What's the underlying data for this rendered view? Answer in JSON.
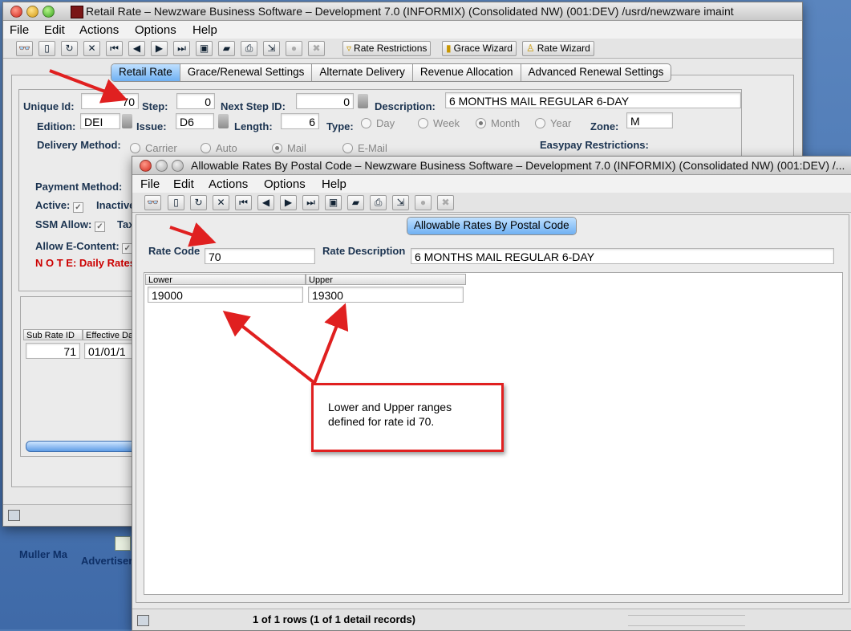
{
  "desktop": {
    "labels": [
      "Muller Ma",
      "Advertiser"
    ]
  },
  "back_window": {
    "title": "Retail Rate – Newzware Business Software – Development 7.0 (INFORMIX) (Consolidated NW)  (001:DEV)  /usrd/newzware  imaint",
    "menu": [
      "File",
      "Edit",
      "Actions",
      "Options",
      "Help"
    ],
    "toolbar_buttons": [
      "Rate Restrictions",
      "Grace Wizard",
      "Rate Wizard"
    ],
    "tabs": [
      "Retail Rate",
      "Grace/Renewal Settings",
      "Alternate Delivery",
      "Revenue Allocation",
      "Advanced Renewal Settings"
    ],
    "form": {
      "unique_id_label": "Unique Id:",
      "unique_id": "70",
      "step_label": "Step:",
      "step": "0",
      "next_step_label": "Next Step ID:",
      "next_step": "0",
      "description_label": "Description:",
      "description": "6 MONTHS MAIL REGULAR 6-DAY",
      "edition_label": "Edition:",
      "edition": "DEI",
      "issue_label": "Issue:",
      "issue": "D6",
      "length_label": "Length:",
      "length": "6",
      "type_label": "Type:",
      "type_options": [
        "Day",
        "Week",
        "Month",
        "Year"
      ],
      "zone_label": "Zone:",
      "zone": "M",
      "delivery_method_label": "Delivery Method:",
      "delivery_options": [
        "Carrier",
        "Auto",
        "Mail",
        "E-Mail"
      ],
      "easypay_label": "Easypay Restrictions:",
      "payment_method_label": "Payment Method:",
      "active_label": "Active:",
      "inactive_label": "Inactive",
      "ssm_allow_label": "SSM Allow:",
      "tax_label": "Tax",
      "allow_econtent_label": "Allow E-Content:",
      "note": "N O T E: Daily Rates"
    },
    "sub_table": {
      "headers": [
        "Sub Rate ID",
        "Effective Da"
      ],
      "row": [
        "71",
        "01/01/1"
      ]
    }
  },
  "front_window": {
    "title": "Allowable Rates By Postal Code – Newzware Business Software – Development 7.0 (INFORMIX) (Consolidated NW)  (001:DEV)  /...",
    "menu": [
      "File",
      "Edit",
      "Actions",
      "Options",
      "Help"
    ],
    "tab": "Allowable Rates By Postal Code",
    "rate_code_label": "Rate Code",
    "rate_code": "70",
    "rate_desc_label": "Rate Description",
    "rate_desc": "6 MONTHS MAIL REGULAR 6-DAY",
    "columns": [
      "Lower",
      "Upper"
    ],
    "rows": [
      [
        "19000",
        "19300"
      ]
    ],
    "status": "1 of 1 rows (1 of 1 detail records)"
  },
  "callout": {
    "line1": "Lower and Upper ranges",
    "line2": "defined for rate id 70."
  },
  "colors": {
    "annotation_red": "#e02020",
    "tab_selected": "#6fb0f2",
    "note_red": "#cc0000"
  }
}
